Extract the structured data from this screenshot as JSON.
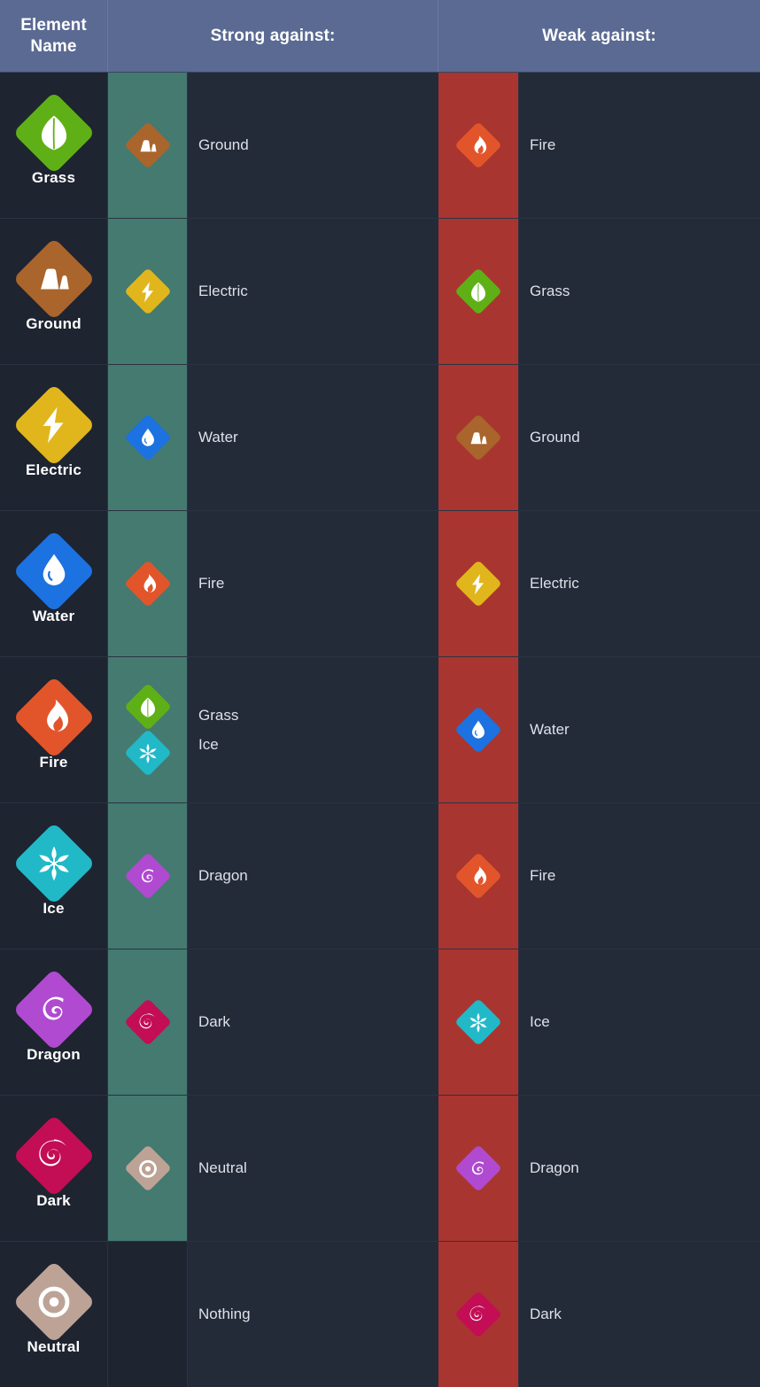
{
  "header": {
    "col_name": "Element\nName",
    "col_name_line1": "Element",
    "col_name_line2": "Name",
    "col_strong": "Strong against:",
    "col_weak": "Weak against:"
  },
  "colors": {
    "header_bg": "#5a6a93",
    "page_bg": "#1e2430",
    "cell_bg": "#232a38",
    "strong_col_bg": "#447a70",
    "weak_col_bg": "#a93530",
    "label_text": "#dde1e8",
    "name_text": "#ffffff",
    "grid_line": "#2b3342"
  },
  "element_colors": {
    "Grass": "#5fb016",
    "Ground": "#a9652c",
    "Electric": "#e0b61c",
    "Water": "#1b72e0",
    "Fire": "#e2552b",
    "Ice": "#21b9c8",
    "Dragon": "#b04ad0",
    "Dark": "#c30d54",
    "Neutral": "#bda396"
  },
  "rows": [
    {
      "name": "Grass",
      "icon": "leaf-icon",
      "strong": [
        {
          "label": "Ground",
          "icon": "mountain-icon"
        }
      ],
      "weak": [
        {
          "label": "Fire",
          "icon": "flame-icon"
        }
      ]
    },
    {
      "name": "Ground",
      "icon": "mountain-icon",
      "strong": [
        {
          "label": "Electric",
          "icon": "bolt-icon"
        }
      ],
      "weak": [
        {
          "label": "Grass",
          "icon": "leaf-icon"
        }
      ]
    },
    {
      "name": "Electric",
      "icon": "bolt-icon",
      "strong": [
        {
          "label": "Water",
          "icon": "droplet-icon"
        }
      ],
      "weak": [
        {
          "label": "Ground",
          "icon": "mountain-icon"
        }
      ]
    },
    {
      "name": "Water",
      "icon": "droplet-icon",
      "strong": [
        {
          "label": "Fire",
          "icon": "flame-icon"
        }
      ],
      "weak": [
        {
          "label": "Electric",
          "icon": "bolt-icon"
        }
      ]
    },
    {
      "name": "Fire",
      "icon": "flame-icon",
      "strong": [
        {
          "label": "Grass",
          "icon": "leaf-icon"
        },
        {
          "label": "Ice",
          "icon": "snowflake-icon"
        }
      ],
      "weak": [
        {
          "label": "Water",
          "icon": "droplet-icon"
        }
      ]
    },
    {
      "name": "Ice",
      "icon": "snowflake-icon",
      "strong": [
        {
          "label": "Dragon",
          "icon": "dragon-icon"
        }
      ],
      "weak": [
        {
          "label": "Fire",
          "icon": "flame-icon"
        }
      ]
    },
    {
      "name": "Dragon",
      "icon": "dragon-icon",
      "strong": [
        {
          "label": "Dark",
          "icon": "spiral-icon"
        }
      ],
      "weak": [
        {
          "label": "Ice",
          "icon": "snowflake-icon"
        }
      ]
    },
    {
      "name": "Dark",
      "icon": "spiral-icon",
      "strong": [
        {
          "label": "Neutral",
          "icon": "target-icon"
        }
      ],
      "weak": [
        {
          "label": "Dragon",
          "icon": "dragon-icon"
        }
      ]
    },
    {
      "name": "Neutral",
      "icon": "target-icon",
      "strong": [
        {
          "label": "Nothing",
          "icon": null
        }
      ],
      "weak": [
        {
          "label": "Dark",
          "icon": "spiral-icon"
        }
      ]
    }
  ]
}
